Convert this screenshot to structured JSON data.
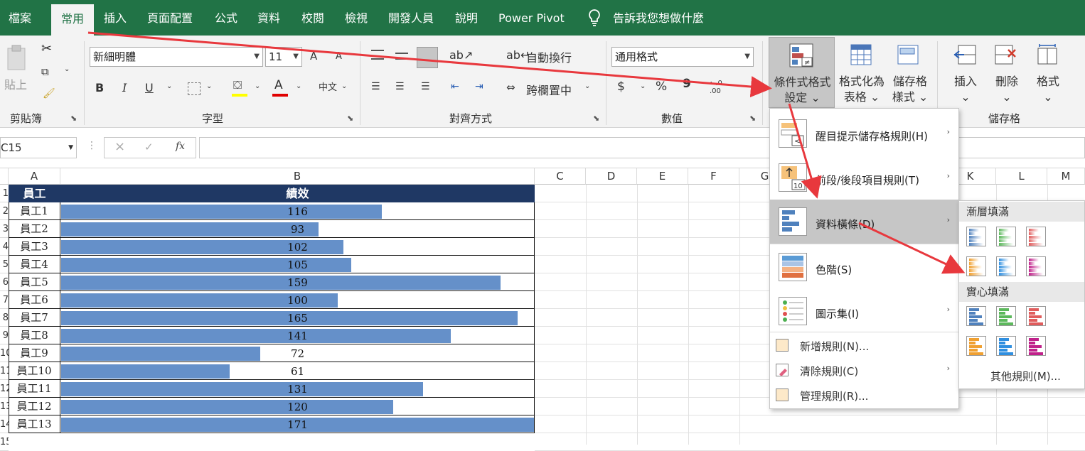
{
  "tabs": [
    "檔案",
    "常用",
    "插入",
    "頁面配置",
    "公式",
    "資料",
    "校閱",
    "檢視",
    "開發人員",
    "說明",
    "Power Pivot"
  ],
  "active_tab": "常用",
  "tell_me": "告訴我您想做什麼",
  "ribbon": {
    "clipboard": {
      "paste": "貼上",
      "label": "剪貼簿"
    },
    "font": {
      "name": "新細明體",
      "size": "11",
      "grow": "A",
      "shrink": "A",
      "bold": "B",
      "italic": "I",
      "underline": "U",
      "color_letter": "A",
      "label": "字型"
    },
    "alignment": {
      "wrap": "自動換行",
      "merge": "跨欄置中",
      "label": "對齊方式"
    },
    "number": {
      "format": "通用格式",
      "currency": "$",
      "percent": "%",
      "comma": "9",
      "label": "數值"
    },
    "styles": {
      "conditional": [
        "條件式格式",
        "設定"
      ],
      "as_table": [
        "格式化為",
        "表格"
      ],
      "cell_styles": [
        "儲存格",
        "樣式"
      ]
    },
    "cells": {
      "insert": "插入",
      "delete": "刪除",
      "format": "格式",
      "label": "儲存格"
    }
  },
  "formula_bar": {
    "name_box": "C15",
    "fx": "fx",
    "cancel": "×",
    "enter": "✓"
  },
  "columns": [
    "A",
    "B",
    "C",
    "D",
    "E",
    "F",
    "G",
    "K",
    "L",
    "M"
  ],
  "row_numbers": [
    "1",
    "2",
    "3",
    "4",
    "5",
    "6",
    "7",
    "8",
    "9",
    "10",
    "11",
    "12",
    "13",
    "14",
    "15"
  ],
  "table": {
    "header": [
      "員工",
      "績效"
    ],
    "max": 171,
    "rows": [
      {
        "name": "員工1",
        "value": 116
      },
      {
        "name": "員工2",
        "value": 93
      },
      {
        "name": "員工3",
        "value": 102
      },
      {
        "name": "員工4",
        "value": 105
      },
      {
        "name": "員工5",
        "value": 159
      },
      {
        "name": "員工6",
        "value": 100
      },
      {
        "name": "員工7",
        "value": 165
      },
      {
        "name": "員工8",
        "value": 141
      },
      {
        "name": "員工9",
        "value": 72
      },
      {
        "name": "員工10",
        "value": 61
      },
      {
        "name": "員工11",
        "value": 131
      },
      {
        "name": "員工12",
        "value": 120
      },
      {
        "name": "員工13",
        "value": 171
      }
    ]
  },
  "cf_menu": {
    "items": [
      "醒目提示儲存格規則(H)",
      "前段/後段項目規則(T)",
      "資料橫條(D)",
      "色階(S)",
      "圖示集(I)"
    ],
    "small_items": [
      "新增規則(N)...",
      "清除規則(C)",
      "管理規則(R)..."
    ]
  },
  "databar_submenu": {
    "gradient_header": "漸層填滿",
    "solid_header": "實心填滿",
    "colors": [
      "#4f81bd",
      "#5cb85c",
      "#e05c5c",
      "#f0a030",
      "#2f8fe0",
      "#c0208a"
    ],
    "more": "其他規則(M)..."
  },
  "accent_color": "#217346",
  "bar_color": "#6590c9",
  "header_color": "#1f3864"
}
